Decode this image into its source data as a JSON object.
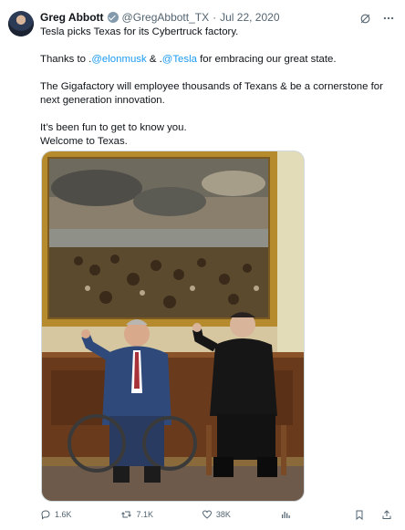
{
  "author": {
    "name": "Greg Abbott",
    "handle": "@GregAbbott_TX",
    "separator": "·",
    "date": "Jul 22, 2020"
  },
  "tweet": {
    "line1": "Tesla picks Texas for its Cybertruck factory.",
    "line2_prefix": "Thanks to .",
    "mention1": "@elonmusk",
    "line2_mid": " & .",
    "mention2": "@Tesla",
    "line2_suffix": " for embracing our great state.",
    "line3": "The Gigafactory will employee thousands of Texans & be a cornerstone for next generation innovation.",
    "line4": "It’s been fun to get to know you.",
    "line5": "Welcome to Texas."
  },
  "actions": {
    "replies": "1.6K",
    "retweets": "7.1K",
    "likes": "38K"
  },
  "icons": {
    "verified": "verified-badge-icon",
    "grok": "grok-icon",
    "more": "more-icon",
    "reply": "reply-icon",
    "retweet": "retweet-icon",
    "like": "heart-icon",
    "views": "views-icon",
    "bookmark": "bookmark-icon",
    "share": "share-icon"
  },
  "colors": {
    "text": "#0f1419",
    "secondary": "#536471",
    "link": "#1d9bf0",
    "border": "#cfd9de"
  }
}
